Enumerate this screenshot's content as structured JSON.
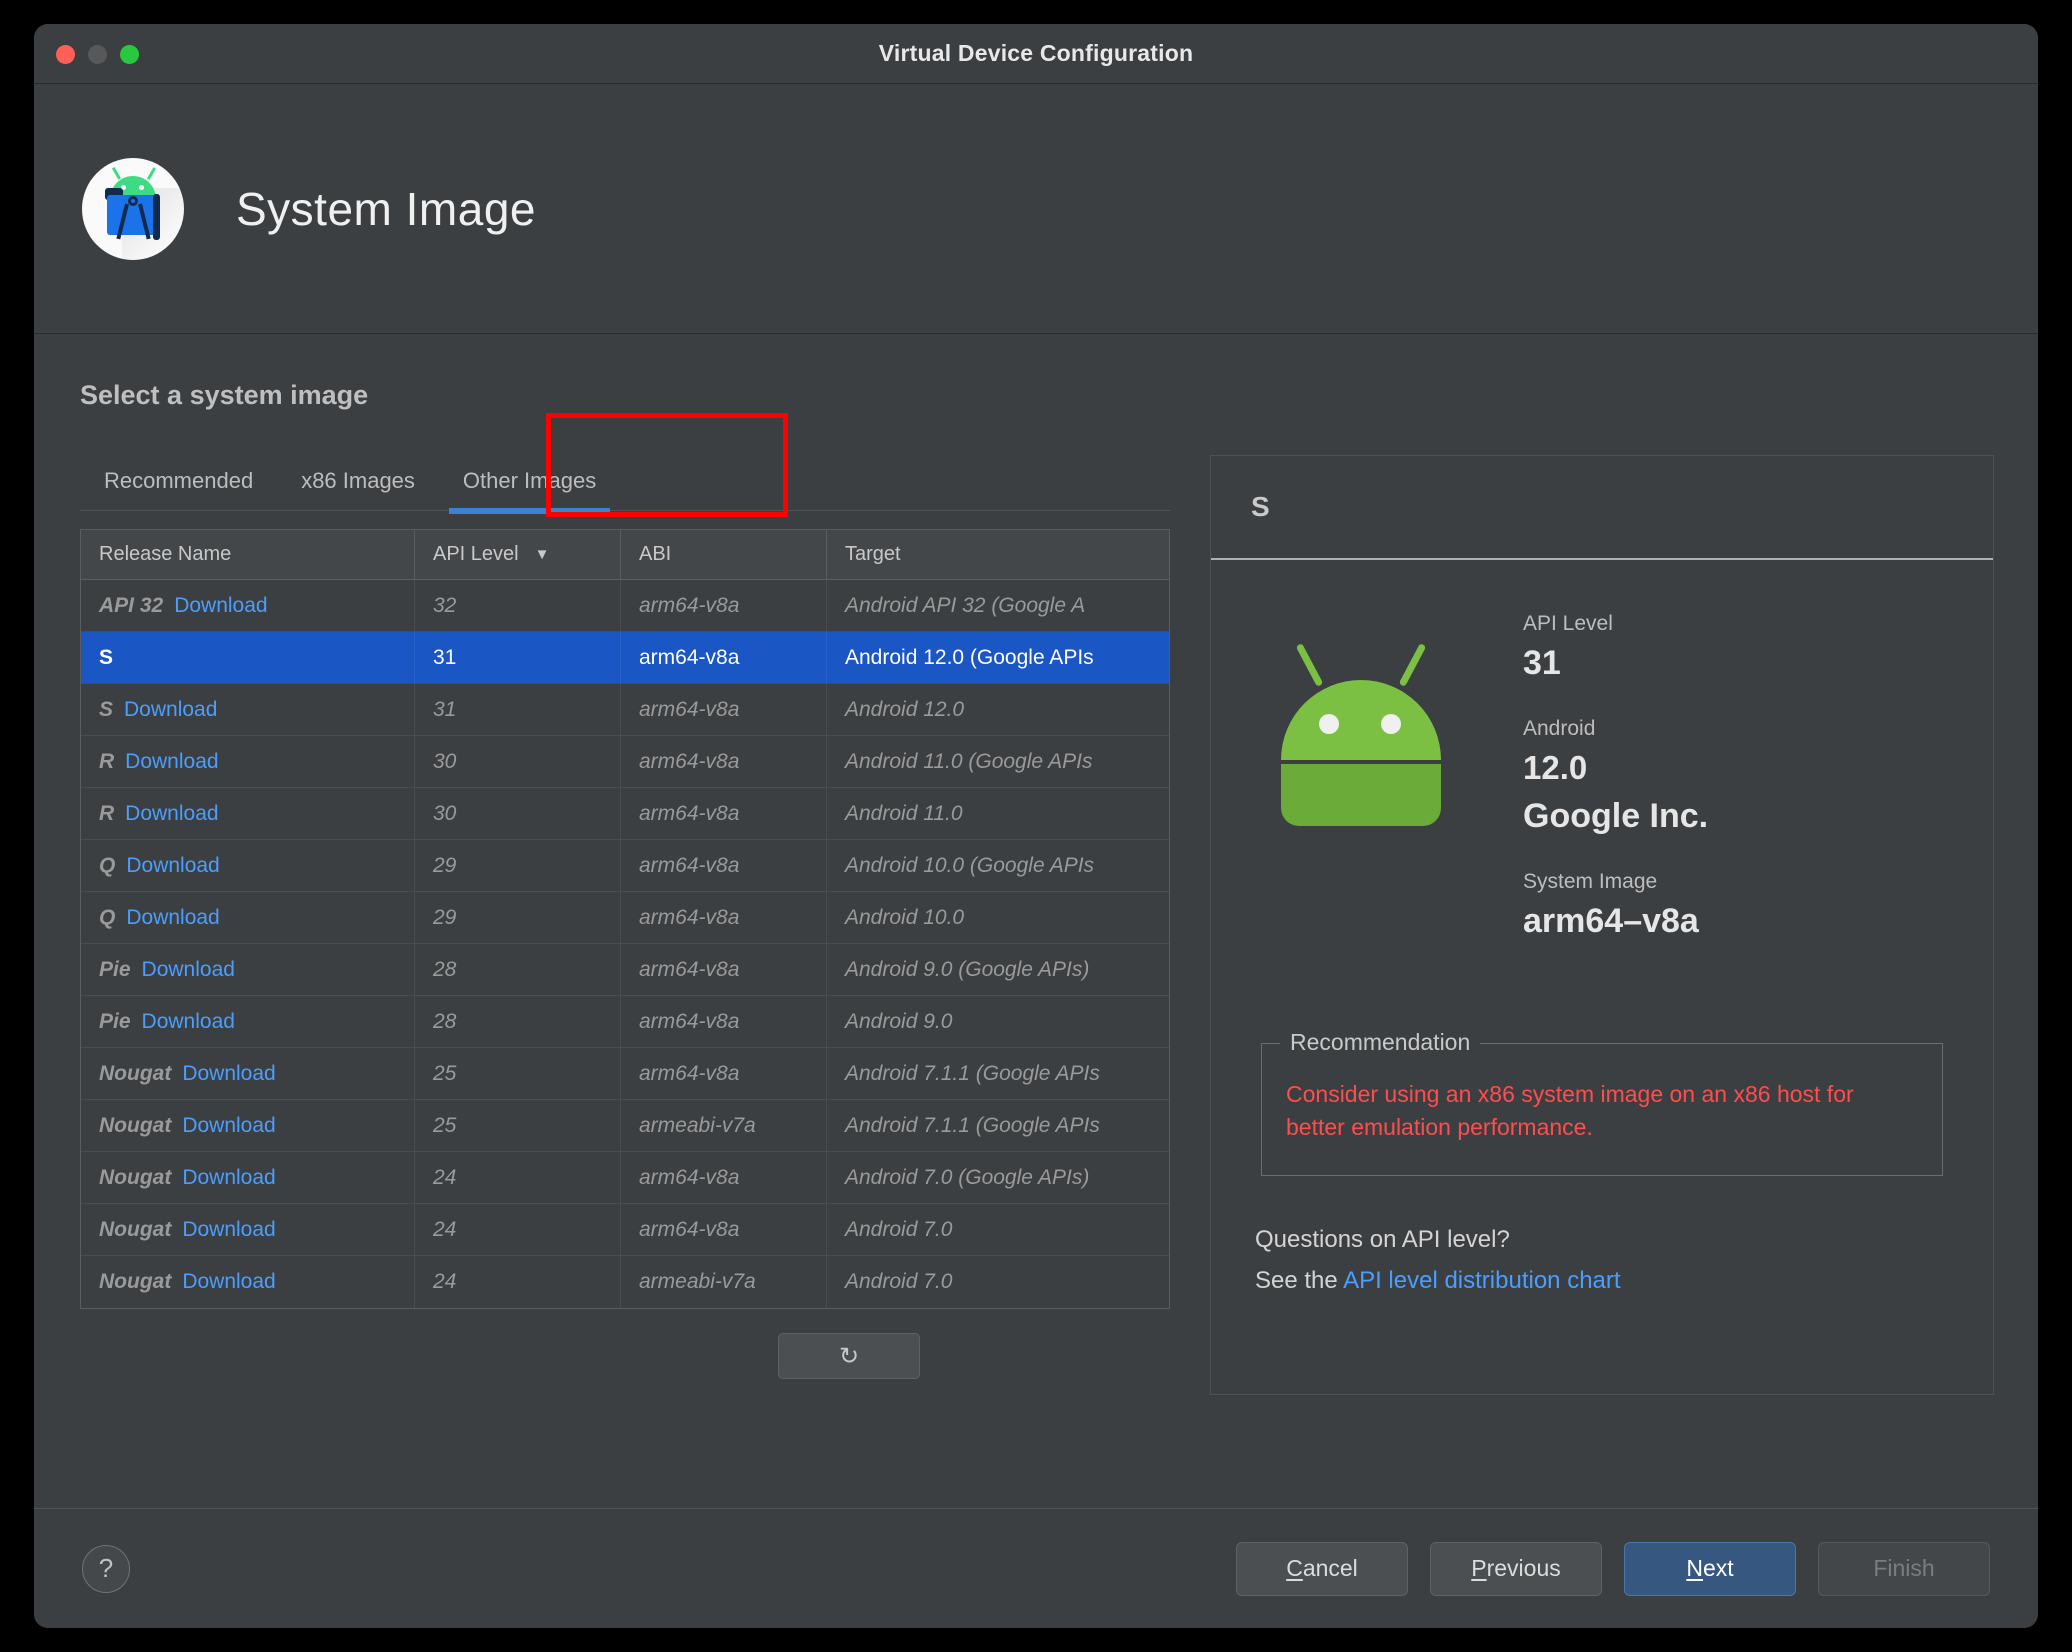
{
  "window": {
    "title": "Virtual Device Configuration",
    "traffic_lights": [
      "close",
      "minimize",
      "zoom"
    ]
  },
  "header": {
    "title": "System Image",
    "logo_icon": "android-studio-icon"
  },
  "main": {
    "section_title": "Select a system image",
    "tabs": [
      {
        "label": "Recommended",
        "active": false
      },
      {
        "label": "x86 Images",
        "active": false
      },
      {
        "label": "Other Images",
        "active": true
      }
    ],
    "highlight_color": "#ff0000",
    "table": {
      "columns": [
        "Release Name",
        "API Level",
        "ABI",
        "Target"
      ],
      "sorted_column": "API Level",
      "sort_direction": "descending",
      "sort_arrow_icon": "chevron-down-icon",
      "download_label": "Download",
      "rows": [
        {
          "release": "API 32",
          "download": true,
          "api": "32",
          "abi": "arm64-v8a",
          "target": "Android API 32 (Google A",
          "selected": false
        },
        {
          "release": "S",
          "download": false,
          "api": "31",
          "abi": "arm64-v8a",
          "target": "Android 12.0 (Google APIs",
          "selected": true
        },
        {
          "release": "S",
          "download": true,
          "api": "31",
          "abi": "arm64-v8a",
          "target": "Android 12.0",
          "selected": false
        },
        {
          "release": "R",
          "download": true,
          "api": "30",
          "abi": "arm64-v8a",
          "target": "Android 11.0 (Google APIs",
          "selected": false
        },
        {
          "release": "R",
          "download": true,
          "api": "30",
          "abi": "arm64-v8a",
          "target": "Android 11.0",
          "selected": false
        },
        {
          "release": "Q",
          "download": true,
          "api": "29",
          "abi": "arm64-v8a",
          "target": "Android 10.0 (Google APIs",
          "selected": false
        },
        {
          "release": "Q",
          "download": true,
          "api": "29",
          "abi": "arm64-v8a",
          "target": "Android 10.0",
          "selected": false
        },
        {
          "release": "Pie",
          "download": true,
          "api": "28",
          "abi": "arm64-v8a",
          "target": "Android 9.0 (Google APIs)",
          "selected": false
        },
        {
          "release": "Pie",
          "download": true,
          "api": "28",
          "abi": "arm64-v8a",
          "target": "Android 9.0",
          "selected": false
        },
        {
          "release": "Nougat",
          "download": true,
          "api": "25",
          "abi": "arm64-v8a",
          "target": "Android 7.1.1 (Google APIs",
          "selected": false
        },
        {
          "release": "Nougat",
          "download": true,
          "api": "25",
          "abi": "armeabi-v7a",
          "target": "Android 7.1.1 (Google APIs",
          "selected": false
        },
        {
          "release": "Nougat",
          "download": true,
          "api": "24",
          "abi": "arm64-v8a",
          "target": "Android 7.0 (Google APIs)",
          "selected": false
        },
        {
          "release": "Nougat",
          "download": true,
          "api": "24",
          "abi": "arm64-v8a",
          "target": "Android 7.0",
          "selected": false
        },
        {
          "release": "Nougat",
          "download": true,
          "api": "24",
          "abi": "armeabi-v7a",
          "target": "Android 7.0",
          "selected": false
        }
      ]
    },
    "refresh_button": {
      "icon": "refresh-icon",
      "glyph": "↻"
    }
  },
  "detail": {
    "title": "S",
    "droid_icon": "android-robot-icon",
    "fields": [
      {
        "label": "API Level",
        "value": "31"
      },
      {
        "label": "Android",
        "value": "12.0"
      },
      {
        "label": "",
        "value": "Google Inc."
      },
      {
        "label": "System Image",
        "value": "arm64–v8a"
      }
    ],
    "recommendation": {
      "legend": "Recommendation",
      "text": "Consider using an x86 system image on an x86 host for better emulation performance.",
      "color": "#ff4d4d"
    },
    "questions": {
      "line1": "Questions on API level?",
      "line2_prefix": "See the ",
      "link": "API level distribution chart"
    }
  },
  "footer": {
    "help_label": "?",
    "buttons": [
      {
        "label": "Cancel",
        "mnemonic": "C",
        "style": "normal"
      },
      {
        "label": "Previous",
        "mnemonic": "P",
        "style": "normal"
      },
      {
        "label": "Next",
        "mnemonic": "N",
        "style": "primary"
      },
      {
        "label": "Finish",
        "mnemonic": "",
        "style": "disabled"
      }
    ]
  }
}
